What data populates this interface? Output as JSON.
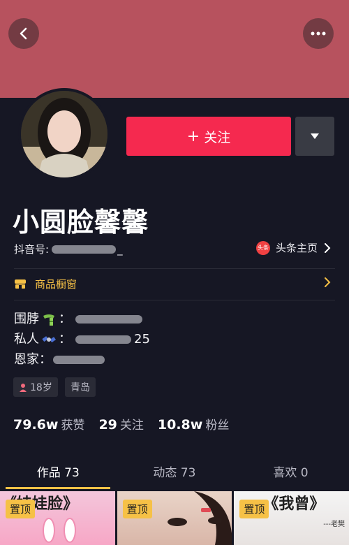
{
  "profile": {
    "username": "小圆脸馨馨",
    "douyin_id_label": "抖音号:",
    "douyin_id_suffix": "_",
    "toutiao_label": "头条主页",
    "toutiao_badge": "头条"
  },
  "actions": {
    "follow_plus": "+",
    "follow_label": "关注"
  },
  "shop": {
    "label": "商品橱窗"
  },
  "bio": {
    "line1_label": "围脖",
    "line1_sep": "：",
    "line2_label": "私人",
    "line2_sep": "：",
    "line2_suffix": "25",
    "line3_label": "恩家："
  },
  "tags": {
    "age": "18岁",
    "city": "青岛"
  },
  "stats": [
    {
      "value": "79.6w",
      "label": "获赞"
    },
    {
      "value": "29",
      "label": "关注"
    },
    {
      "value": "10.8w",
      "label": "粉丝"
    }
  ],
  "tabs": [
    {
      "label": "作品 73"
    },
    {
      "label": "动态 73"
    },
    {
      "label": "喜欢 0"
    }
  ],
  "grid": {
    "pin_label": "置顶",
    "thumb1_caption": "《娃娃脸》",
    "thumb3_caption": "《我曾》",
    "thumb3_sub": "---老樊"
  },
  "colors": {
    "banner": "#b7525e",
    "follow": "#f5294f",
    "accent": "#f6c146",
    "background": "#161724"
  },
  "icons": [
    "back-icon",
    "more-icon",
    "chevron-down-icon",
    "shop-icon",
    "chevron-right-icon",
    "scarf-emoji",
    "satellite-emoji",
    "person-icon"
  ]
}
